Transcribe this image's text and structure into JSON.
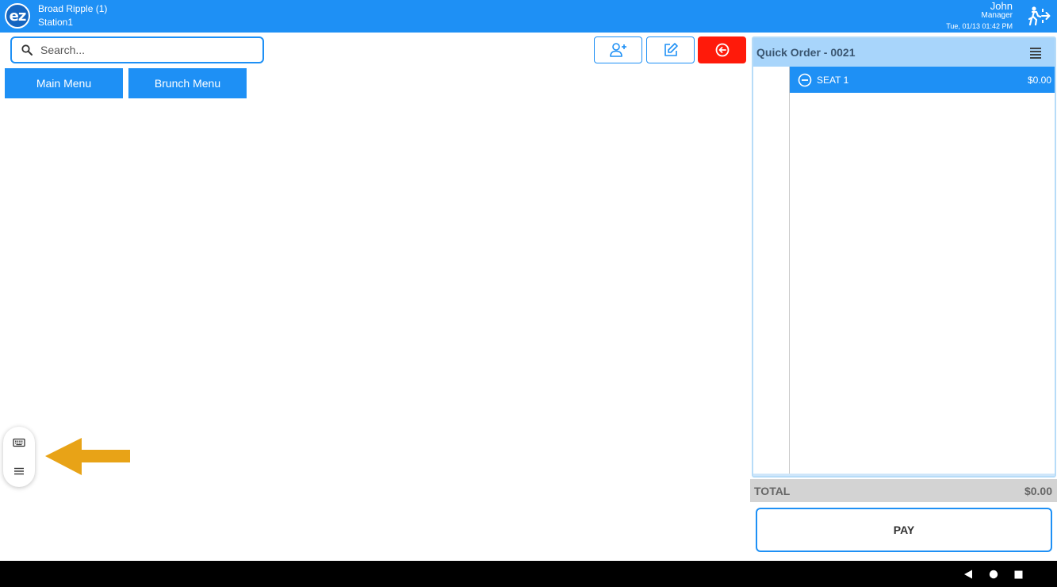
{
  "header": {
    "logo_text": "ez",
    "store": "Broad Ripple (1)",
    "station": "Station1",
    "user": "John",
    "role": "Manager",
    "datetime": "Tue, 01/13 01:42 PM",
    "logout_icon": "logout-person-icon"
  },
  "search": {
    "placeholder": "Search...",
    "value": ""
  },
  "menus": [
    {
      "label": "Main Menu"
    },
    {
      "label": "Brunch Menu"
    }
  ],
  "actions": {
    "add_customer_icon": "add-person-icon",
    "edit_icon": "edit-icon",
    "back_icon": "circle-arrow-left-icon"
  },
  "order": {
    "title": "Quick Order - 0021",
    "seats": [
      {
        "label": "SEAT 1",
        "amount": "$0.00"
      }
    ],
    "total_label": "TOTAL",
    "total_amount": "$0.00",
    "pay_label": "PAY"
  },
  "colors": {
    "primary": "#1e90f5",
    "danger": "#ff1a0a",
    "header_light": "#a8d5fb",
    "arrow": "#e8a317"
  }
}
